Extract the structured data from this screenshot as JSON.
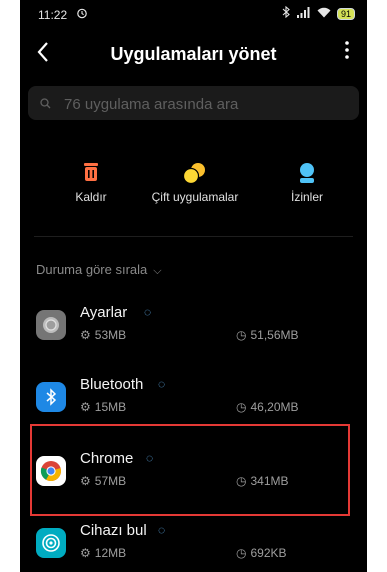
{
  "status_bar": {
    "time": "11:22",
    "battery": "91"
  },
  "header": {
    "title": "Uygulamaları yönet"
  },
  "search": {
    "placeholder": "76 uygulama arasında ara"
  },
  "actions": [
    {
      "label": "Kaldır",
      "icon": "trash-icon",
      "color": "#ff7043"
    },
    {
      "label": "Çift uygulamalar",
      "icon": "dual-apps-icon",
      "color": "#fbc02d"
    },
    {
      "label": "İzinler",
      "icon": "permissions-icon",
      "color": "#4fc3f7"
    }
  ],
  "sort": {
    "label": "Duruma göre sırala"
  },
  "apps": [
    {
      "name": "Ayarlar",
      "size": "53MB",
      "cache": "51,56MB",
      "icon": "settings-app-icon"
    },
    {
      "name": "Bluetooth",
      "size": "15MB",
      "cache": "46,20MB",
      "icon": "bluetooth-app-icon"
    },
    {
      "name": "Chrome",
      "size": "57MB",
      "cache": "341MB",
      "icon": "chrome-app-icon"
    },
    {
      "name": "Cihazı bul",
      "size": "12MB",
      "cache": "692KB",
      "icon": "find-device-app-icon"
    }
  ]
}
